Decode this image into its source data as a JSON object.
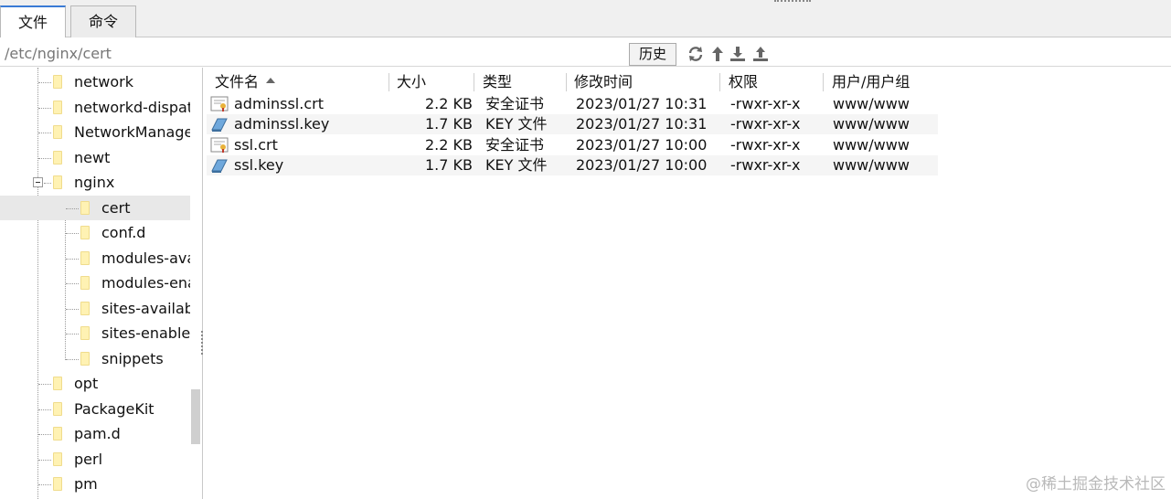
{
  "tabs": [
    {
      "label": "文件",
      "active": true
    },
    {
      "label": "命令",
      "active": false
    }
  ],
  "path": {
    "value": "/etc/nginx/cert"
  },
  "toolbar": {
    "history_label": "历史",
    "icons": [
      "refresh-icon",
      "up-dir-icon",
      "download-icon",
      "upload-icon"
    ]
  },
  "tree": {
    "items": [
      {
        "label": "network",
        "level": 1
      },
      {
        "label": "networkd-dispatcher",
        "level": 1
      },
      {
        "label": "NetworkManager",
        "level": 1
      },
      {
        "label": "newt",
        "level": 1
      },
      {
        "label": "nginx",
        "level": 1,
        "expanded": true
      },
      {
        "label": "cert",
        "level": 2,
        "selected": true
      },
      {
        "label": "conf.d",
        "level": 2
      },
      {
        "label": "modules-available",
        "level": 2
      },
      {
        "label": "modules-enabled",
        "level": 2
      },
      {
        "label": "sites-available",
        "level": 2
      },
      {
        "label": "sites-enabled",
        "level": 2
      },
      {
        "label": "snippets",
        "level": 2
      },
      {
        "label": "opt",
        "level": 1
      },
      {
        "label": "PackageKit",
        "level": 1
      },
      {
        "label": "pam.d",
        "level": 1
      },
      {
        "label": "perl",
        "level": 1
      },
      {
        "label": "pm",
        "level": 1
      }
    ]
  },
  "files": {
    "columns": [
      "文件名",
      "大小",
      "类型",
      "修改时间",
      "权限",
      "用户/用户组"
    ],
    "sort_column": "文件名",
    "rows": [
      {
        "name": "adminssl.crt",
        "size": "2.2 KB",
        "type": "安全证书",
        "mtime": "2023/01/27 10:31",
        "perm": "-rwxr-xr-x",
        "owner": "www/www",
        "icon": "certificate-icon"
      },
      {
        "name": "adminssl.key",
        "size": "1.7 KB",
        "type": "KEY 文件",
        "mtime": "2023/01/27 10:31",
        "perm": "-rwxr-xr-x",
        "owner": "www/www",
        "icon": "key-file-icon"
      },
      {
        "name": "ssl.crt",
        "size": "2.2 KB",
        "type": "安全证书",
        "mtime": "2023/01/27 10:00",
        "perm": "-rwxr-xr-x",
        "owner": "www/www",
        "icon": "certificate-icon"
      },
      {
        "name": "ssl.key",
        "size": "1.7 KB",
        "type": "KEY 文件",
        "mtime": "2023/01/27 10:00",
        "perm": "-rwxr-xr-x",
        "owner": "www/www",
        "icon": "key-file-icon"
      }
    ]
  },
  "watermark": "@稀土掘金技术社区"
}
